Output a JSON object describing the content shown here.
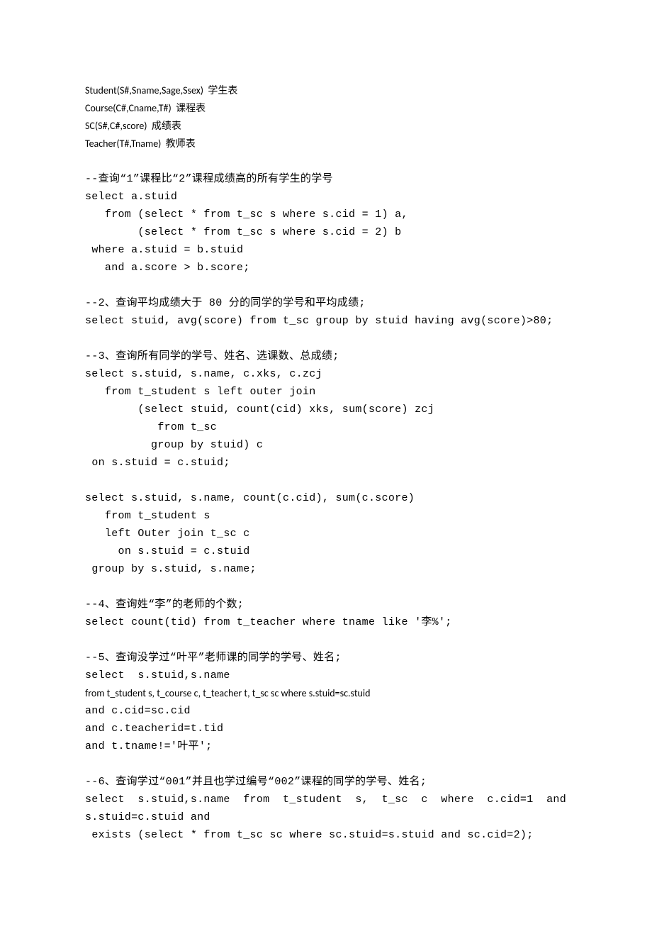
{
  "lines": [
    {
      "cls": "line sans",
      "text": "Student(S#,Sname,Sage,Ssex)  学生表"
    },
    {
      "cls": "line sans",
      "text": "Course(C#,Cname,T#)  课程表"
    },
    {
      "cls": "line sans",
      "text": "SC(S#,C#,score)  成绩表"
    },
    {
      "cls": "line sans",
      "text": "Teacher(T#,Tname)  教师表"
    },
    {
      "cls": "blank",
      "text": ""
    },
    {
      "cls": "line mono",
      "text": "--查询“1”课程比“2”课程成绩高的所有学生的学号"
    },
    {
      "cls": "line mono",
      "text": "select a.stuid"
    },
    {
      "cls": "line mono",
      "text": "   from (select * from t_sc s where s.cid = 1) a,"
    },
    {
      "cls": "line mono",
      "text": "        (select * from t_sc s where s.cid = 2) b"
    },
    {
      "cls": "line mono",
      "text": " where a.stuid = b.stuid"
    },
    {
      "cls": "line mono",
      "text": "   and a.score > b.score;"
    },
    {
      "cls": "blank",
      "text": ""
    },
    {
      "cls": "line mono",
      "text": "--2、查询平均成绩大于 80 分的同学的学号和平均成绩;"
    },
    {
      "cls": "line mono",
      "text": "select stuid, avg(score) from t_sc group by stuid having avg(score)>80;"
    },
    {
      "cls": "blank",
      "text": ""
    },
    {
      "cls": "line mono",
      "text": "--3、查询所有同学的学号、姓名、选课数、总成绩;"
    },
    {
      "cls": "line mono",
      "text": "select s.stuid, s.name, c.xks, c.zcj"
    },
    {
      "cls": "line mono",
      "text": "   from t_student s left outer join"
    },
    {
      "cls": "line mono",
      "text": "        (select stuid, count(cid) xks, sum(score) zcj"
    },
    {
      "cls": "line mono",
      "text": "           from t_sc"
    },
    {
      "cls": "line mono",
      "text": "          group by stuid) c"
    },
    {
      "cls": "line mono",
      "text": " on s.stuid = c.stuid;"
    },
    {
      "cls": "blank",
      "text": ""
    },
    {
      "cls": "line mono",
      "text": "select s.stuid, s.name, count(c.cid), sum(c.score)"
    },
    {
      "cls": "line mono",
      "text": "   from t_student s"
    },
    {
      "cls": "line mono",
      "text": "   left Outer join t_sc c"
    },
    {
      "cls": "line mono",
      "text": "     on s.stuid = c.stuid"
    },
    {
      "cls": "line mono",
      "text": " group by s.stuid, s.name;"
    },
    {
      "cls": "blank",
      "text": ""
    },
    {
      "cls": "line mono",
      "text": "--4、查询姓“李”的老师的个数;"
    },
    {
      "cls": "line mono",
      "text": "select count(tid) from t_teacher where tname like '李%';"
    },
    {
      "cls": "blank",
      "text": ""
    },
    {
      "cls": "line mono",
      "text": "--5、查询没学过“叶平”老师课的同学的学号、姓名;"
    },
    {
      "cls": "line mono",
      "text": "select  s.stuid,s.name"
    },
    {
      "cls": "line sans",
      "text": "from t_student s, t_course c, t_teacher t, t_sc sc where s.stuid=sc.stuid"
    },
    {
      "cls": "line mono",
      "text": "and c.cid=sc.cid"
    },
    {
      "cls": "line mono",
      "text": "and c.teacherid=t.tid"
    },
    {
      "cls": "line mono",
      "text": "and t.tname!='叶平';"
    },
    {
      "cls": "blank",
      "text": ""
    },
    {
      "cls": "line mono",
      "text": "--6、查询学过“001”并且也学过编号“002”课程的同学的学号、姓名;"
    },
    {
      "cls": "line mono",
      "text": "select  s.stuid,s.name  from  t_student  s,  t_sc  c  where  c.cid=1  and s.stuid=c.stuid and"
    },
    {
      "cls": "line mono",
      "text": " exists (select * from t_sc sc where sc.stuid=s.stuid and sc.cid=2);"
    }
  ]
}
